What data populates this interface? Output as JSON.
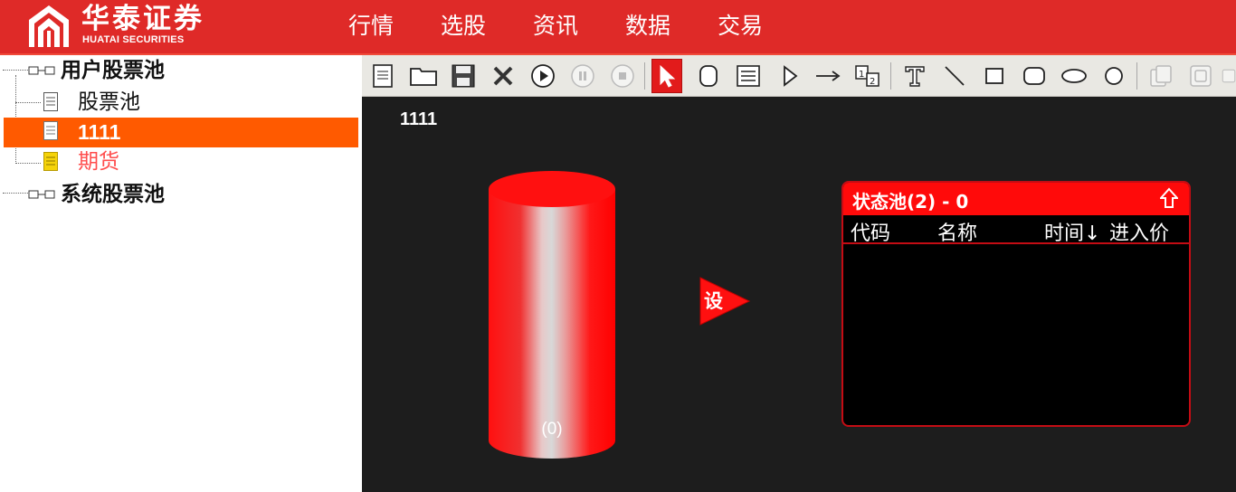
{
  "header": {
    "brand_cn": "华泰证券",
    "brand_en": "HUATAI SECURITIES",
    "nav": [
      "行情",
      "选股",
      "资讯",
      "数据",
      "交易"
    ]
  },
  "tree": {
    "user_pool": "用户股票池",
    "items": [
      "股票池",
      "1111",
      "期货"
    ],
    "system_pool": "系统股票池"
  },
  "toolbar": {
    "icons": [
      "new-icon",
      "open-icon",
      "save-icon",
      "delete-icon",
      "play-icon",
      "pause-icon",
      "stop-icon",
      "pointer-icon",
      "cylinder-icon",
      "list-icon",
      "triangle-icon",
      "arrow-icon",
      "sequence-icon",
      "text-icon",
      "line-icon",
      "rectangle-icon",
      "rounded-rect-icon",
      "ellipse-icon",
      "circle-icon",
      "copy-icon",
      "paste-icon",
      "layer-icon"
    ]
  },
  "canvas": {
    "strategy_name": "1111",
    "pool_count": "(0)",
    "set_label": "设"
  },
  "status_panel": {
    "title": "状态池(2) - 0",
    "columns": [
      "代码",
      "名称",
      "时间↓",
      "进入价"
    ]
  },
  "colors": {
    "brand_red": "#df2a28",
    "selection": "#ff5a00",
    "canvas_bg": "#1d1d1d"
  }
}
